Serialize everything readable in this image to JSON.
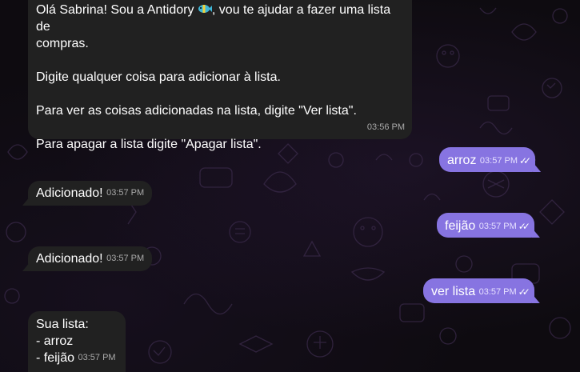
{
  "messages": [
    {
      "side": "in",
      "line1_a": "Olá Sabrina! Sou a Antidory ",
      "emoji": "fish-emoji",
      "line1_b": ", vou te ajudar a fazer uma lista de",
      "line2": "compras.",
      "line3": "Digite qualquer coisa para adicionar à lista.",
      "line4": "Para ver as coisas adicionadas na lista, digite \"Ver lista\".",
      "line5": "Para apagar a lista digite \"Apagar lista\".",
      "time": "03:56 PM"
    },
    {
      "side": "out",
      "text": "arroz",
      "time": "03:57 PM",
      "status": "read"
    },
    {
      "side": "in",
      "text": "Adicionado!",
      "time": "03:57 PM"
    },
    {
      "side": "out",
      "text": "feijão",
      "time": "03:57 PM",
      "status": "read"
    },
    {
      "side": "in",
      "text": "Adicionado!",
      "time": "03:57 PM"
    },
    {
      "side": "out",
      "text": "ver lista",
      "time": "03:57 PM",
      "status": "read"
    },
    {
      "side": "in",
      "line1": "Sua lista:",
      "line2": "- arroz",
      "line3": "- feijão",
      "time": "03:57 PM"
    }
  ],
  "ticks_glyph": "✓✓",
  "colors": {
    "incoming_bubble": "#212121",
    "outgoing_bubble": "#8774e1",
    "background": "#0e0b10"
  }
}
